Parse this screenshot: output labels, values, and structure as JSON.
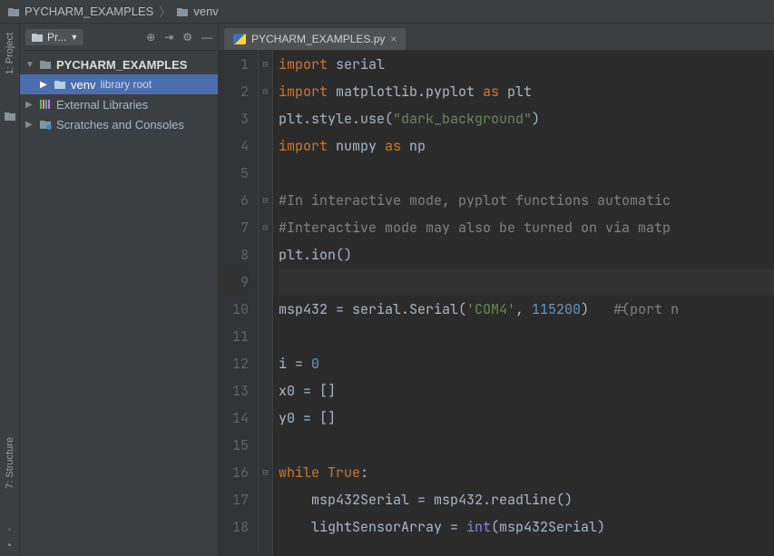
{
  "breadcrumb": {
    "root": "PYCHARM_EXAMPLES",
    "child": "venv"
  },
  "left_rail": {
    "project": "1: Project",
    "structure": "7: Structure"
  },
  "sidebar": {
    "title_short": "Pr...",
    "tree": {
      "root": "PYCHARM_EXAMPLES",
      "venv": "venv",
      "venv_hint": "library root",
      "ext_libs": "External Libraries",
      "scratches": "Scratches and Consoles"
    }
  },
  "tab": {
    "filename": "PYCHARM_EXAMPLES.py"
  },
  "code": {
    "lines": [
      {
        "n": 1,
        "fold": "-",
        "segments": [
          [
            "kw",
            "import"
          ],
          [
            "",
            " serial"
          ]
        ]
      },
      {
        "n": 2,
        "fold": "-",
        "segments": [
          [
            "kw",
            "import"
          ],
          [
            "",
            " matplotlib.pyplot "
          ],
          [
            "kw",
            "as"
          ],
          [
            "",
            " plt"
          ]
        ]
      },
      {
        "n": 3,
        "fold": "",
        "segments": [
          [
            "",
            "plt.style.use("
          ],
          [
            "str",
            "\"dark_background\""
          ],
          [
            "",
            ")"
          ]
        ]
      },
      {
        "n": 4,
        "fold": "",
        "segments": [
          [
            "kw",
            "import"
          ],
          [
            "",
            " numpy "
          ],
          [
            "kw",
            "as"
          ],
          [
            "",
            " np"
          ]
        ]
      },
      {
        "n": 5,
        "fold": "",
        "segments": [
          [
            "",
            ""
          ]
        ]
      },
      {
        "n": 6,
        "fold": "-",
        "segments": [
          [
            "cmt",
            "#In interactive mode, pyplot functions automatic"
          ]
        ]
      },
      {
        "n": 7,
        "fold": "-",
        "segments": [
          [
            "cmt",
            "#Interactive mode may also be turned on via matp"
          ]
        ]
      },
      {
        "n": 8,
        "fold": "",
        "segments": [
          [
            "",
            "plt.ion()"
          ]
        ]
      },
      {
        "n": 9,
        "fold": "",
        "current": true,
        "segments": [
          [
            "",
            ""
          ]
        ]
      },
      {
        "n": 10,
        "fold": "",
        "segments": [
          [
            "",
            "msp432 = serial.Serial("
          ],
          [
            "str",
            "'COM4'"
          ],
          [
            "",
            ", "
          ],
          [
            "num",
            "115200"
          ],
          [
            "",
            ")   "
          ],
          [
            "cmt",
            "#(port n"
          ]
        ]
      },
      {
        "n": 11,
        "fold": "",
        "segments": [
          [
            "",
            ""
          ]
        ]
      },
      {
        "n": 12,
        "fold": "",
        "segments": [
          [
            "",
            "i = "
          ],
          [
            "num",
            "0"
          ]
        ]
      },
      {
        "n": 13,
        "fold": "",
        "segments": [
          [
            "",
            "x0 = []"
          ]
        ]
      },
      {
        "n": 14,
        "fold": "",
        "segments": [
          [
            "",
            "y0 = []"
          ]
        ]
      },
      {
        "n": 15,
        "fold": "",
        "segments": [
          [
            "",
            ""
          ]
        ]
      },
      {
        "n": 16,
        "fold": "-",
        "segments": [
          [
            "kw",
            "while"
          ],
          [
            "",
            " "
          ],
          [
            "kw",
            "True"
          ],
          [
            "",
            ":"
          ]
        ]
      },
      {
        "n": 17,
        "fold": "",
        "segments": [
          [
            "",
            "    msp432Serial = msp432.readline()"
          ]
        ]
      },
      {
        "n": 18,
        "fold": "",
        "segments": [
          [
            "",
            "    lightSensorArray = "
          ],
          [
            "builtin",
            "int"
          ],
          [
            "",
            "(msp432Serial)"
          ]
        ]
      }
    ]
  }
}
